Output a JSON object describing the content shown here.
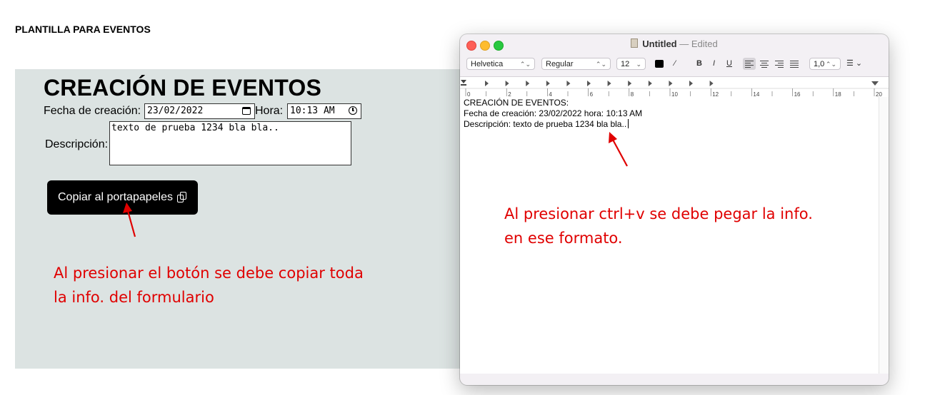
{
  "page": {
    "heading": "PLANTILLA PARA EVENTOS"
  },
  "form": {
    "title": "CREACIÓN DE EVENTOS",
    "date_label": "Fecha de creación:",
    "date_value": "23/02/2022",
    "time_label": "Hora:",
    "time_value": "10:13 AM",
    "description_label": "Descripción:",
    "description_value": "texto de prueba 1234 bla bla..",
    "copy_button_label": "Copiar al portapapeles",
    "copy_icon": "copy-icon",
    "annotation_line1": "Al presionar el botón se debe copiar toda",
    "annotation_line2": "la info. del formulario"
  },
  "textedit": {
    "title": "Untitled",
    "title_separator": "—",
    "title_status": "Edited",
    "toolbar": {
      "font_family": "Helvetica",
      "font_style": "Regular",
      "font_size": "12",
      "bold": "B",
      "italic": "I",
      "underline": "U",
      "line_spacing": "1,0"
    },
    "ruler_labels": [
      "0",
      "2",
      "4",
      "6",
      "8",
      "10",
      "12",
      "14",
      "16",
      "18",
      "20"
    ],
    "document_lines": [
      "CREACIÓN DE EVENTOS:",
      "Fecha de creación: 23/02/2022 hora: 10:13 AM",
      "Descripción: texto de prueba 1234 bla bla.."
    ],
    "annotation_line1": "Al presionar ctrl+v se debe pegar la info.",
    "annotation_line2": "en ese formato."
  },
  "colors": {
    "annotation": "#e00000",
    "panel_bg": "#dce3e2",
    "button_bg": "#000000",
    "close": "#fe5f57",
    "minimize": "#febc2e",
    "zoom": "#28c840"
  }
}
